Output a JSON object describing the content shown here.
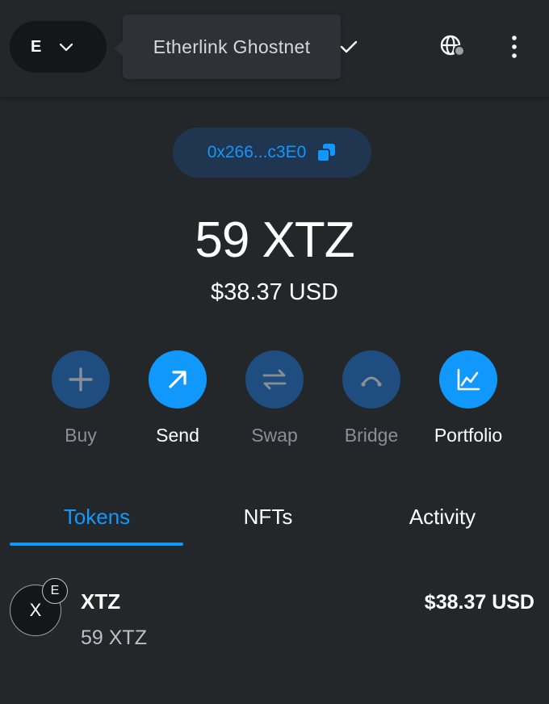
{
  "header": {
    "network_avatar_letter": "E",
    "network_tooltip": "Etherlink Ghostnet",
    "chevron_icon": "chevron-down-icon",
    "check_icon": "check-icon",
    "globe_icon": "globe-connected-icon",
    "menu_icon": "kebab-menu-icon"
  },
  "account": {
    "address_short": "0x266...c3E0",
    "copy_icon": "copy-icon"
  },
  "balance": {
    "primary": "59 XTZ",
    "fiat": "$38.37 USD"
  },
  "actions": [
    {
      "label": "Buy",
      "icon": "plus-icon",
      "state": "disabled"
    },
    {
      "label": "Send",
      "icon": "arrow-up-right-icon",
      "state": "enabled"
    },
    {
      "label": "Swap",
      "icon": "swap-icon",
      "state": "disabled"
    },
    {
      "label": "Bridge",
      "icon": "bridge-icon",
      "state": "disabled"
    },
    {
      "label": "Portfolio",
      "icon": "chart-icon",
      "state": "enabled"
    }
  ],
  "tabs": [
    {
      "label": "Tokens",
      "selected": true
    },
    {
      "label": "NFTs",
      "selected": false
    },
    {
      "label": "Activity",
      "selected": false
    }
  ],
  "tokens": [
    {
      "avatar_letter": "X",
      "badge_letter": "E",
      "name": "XTZ",
      "amount": "59 XTZ",
      "fiat": "$38.37 USD"
    }
  ],
  "colors": {
    "accent": "#1098fc",
    "background": "#24272a",
    "muted_button": "#1f4d80"
  }
}
